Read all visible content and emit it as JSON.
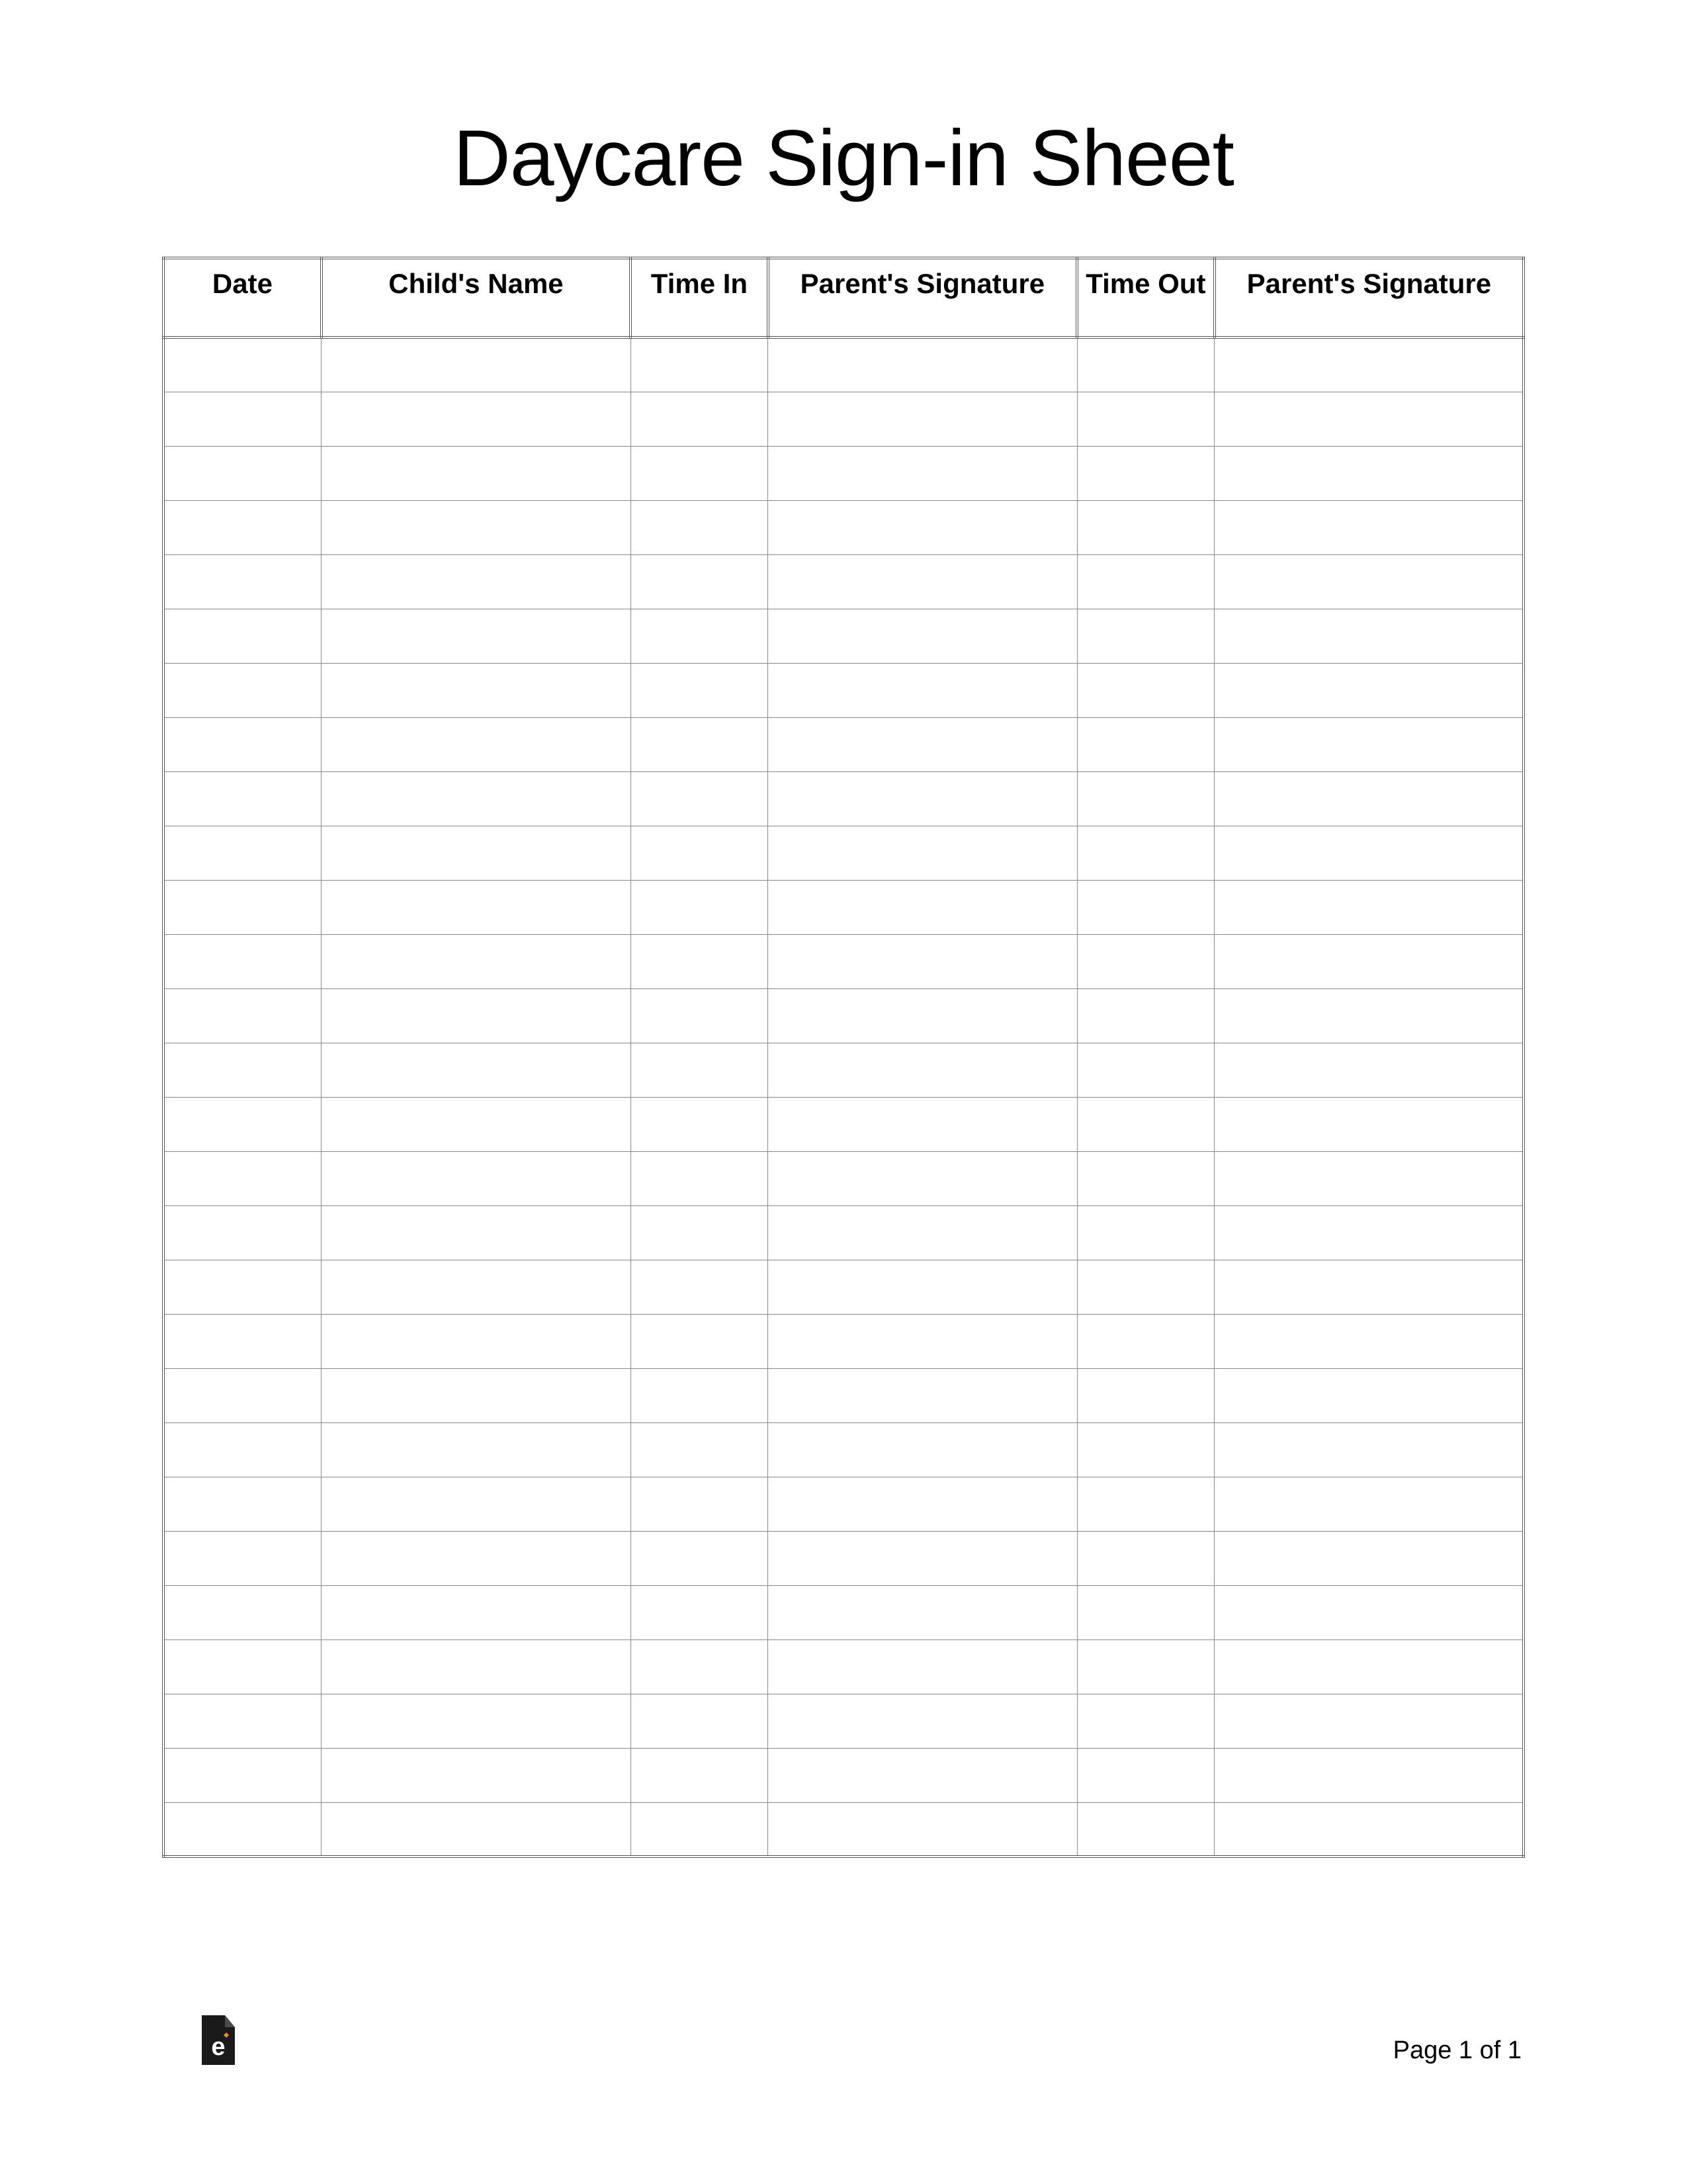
{
  "title": "Daycare Sign-in Sheet",
  "columns": [
    "Date",
    "Child's Name",
    "Time In",
    "Parent's Signature",
    "Time Out",
    "Parent's Signature"
  ],
  "rows": [
    [
      "",
      "",
      "",
      "",
      "",
      ""
    ],
    [
      "",
      "",
      "",
      "",
      "",
      ""
    ],
    [
      "",
      "",
      "",
      "",
      "",
      ""
    ],
    [
      "",
      "",
      "",
      "",
      "",
      ""
    ],
    [
      "",
      "",
      "",
      "",
      "",
      ""
    ],
    [
      "",
      "",
      "",
      "",
      "",
      ""
    ],
    [
      "",
      "",
      "",
      "",
      "",
      ""
    ],
    [
      "",
      "",
      "",
      "",
      "",
      ""
    ],
    [
      "",
      "",
      "",
      "",
      "",
      ""
    ],
    [
      "",
      "",
      "",
      "",
      "",
      ""
    ],
    [
      "",
      "",
      "",
      "",
      "",
      ""
    ],
    [
      "",
      "",
      "",
      "",
      "",
      ""
    ],
    [
      "",
      "",
      "",
      "",
      "",
      ""
    ],
    [
      "",
      "",
      "",
      "",
      "",
      ""
    ],
    [
      "",
      "",
      "",
      "",
      "",
      ""
    ],
    [
      "",
      "",
      "",
      "",
      "",
      ""
    ],
    [
      "",
      "",
      "",
      "",
      "",
      ""
    ],
    [
      "",
      "",
      "",
      "",
      "",
      ""
    ],
    [
      "",
      "",
      "",
      "",
      "",
      ""
    ],
    [
      "",
      "",
      "",
      "",
      "",
      ""
    ],
    [
      "",
      "",
      "",
      "",
      "",
      ""
    ],
    [
      "",
      "",
      "",
      "",
      "",
      ""
    ],
    [
      "",
      "",
      "",
      "",
      "",
      ""
    ],
    [
      "",
      "",
      "",
      "",
      "",
      ""
    ],
    [
      "",
      "",
      "",
      "",
      "",
      ""
    ],
    [
      "",
      "",
      "",
      "",
      "",
      ""
    ],
    [
      "",
      "",
      "",
      "",
      "",
      ""
    ],
    [
      "",
      "",
      "",
      "",
      "",
      ""
    ]
  ],
  "footer": {
    "page_label": "Page 1 of 1"
  }
}
